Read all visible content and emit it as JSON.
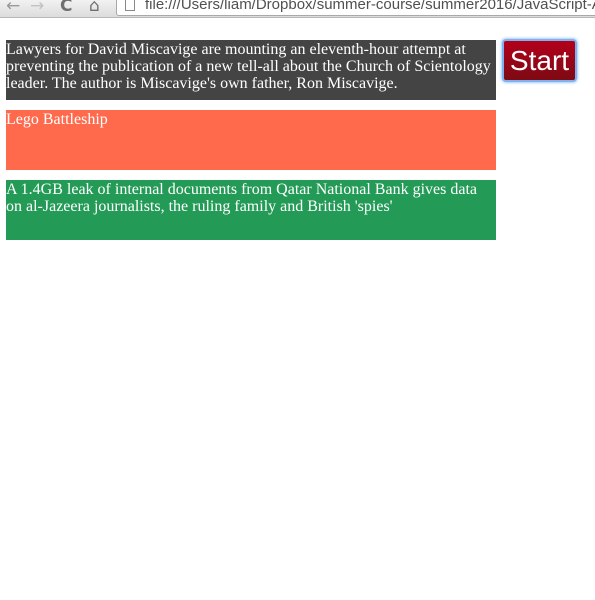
{
  "browser": {
    "url": "file:///Users/liam/Dropbox/summer-course/summer2016/JavaScript-A",
    "icons": {
      "back": "back-arrow-icon",
      "forward": "forward-arrow-icon",
      "reload": "reload-icon",
      "home": "home-icon",
      "page": "page-icon"
    }
  },
  "start_button": {
    "label": "Start"
  },
  "news": [
    {
      "text": "Lawyers for David Miscavige are mounting an eleventh-hour attempt at preventing the publication of a new tell-all about the Church of Scientology leader. The author is Miscavige's own father, Ron Miscavige.",
      "color": "#444444"
    },
    {
      "text": "Lego Battleship",
      "color": "#ff6a4d"
    },
    {
      "text": "A 1.4GB leak of internal documents from Qatar National Bank gives data on al-Jazeera journalists, the ruling family and British 'spies'",
      "color": "#239b57"
    }
  ]
}
